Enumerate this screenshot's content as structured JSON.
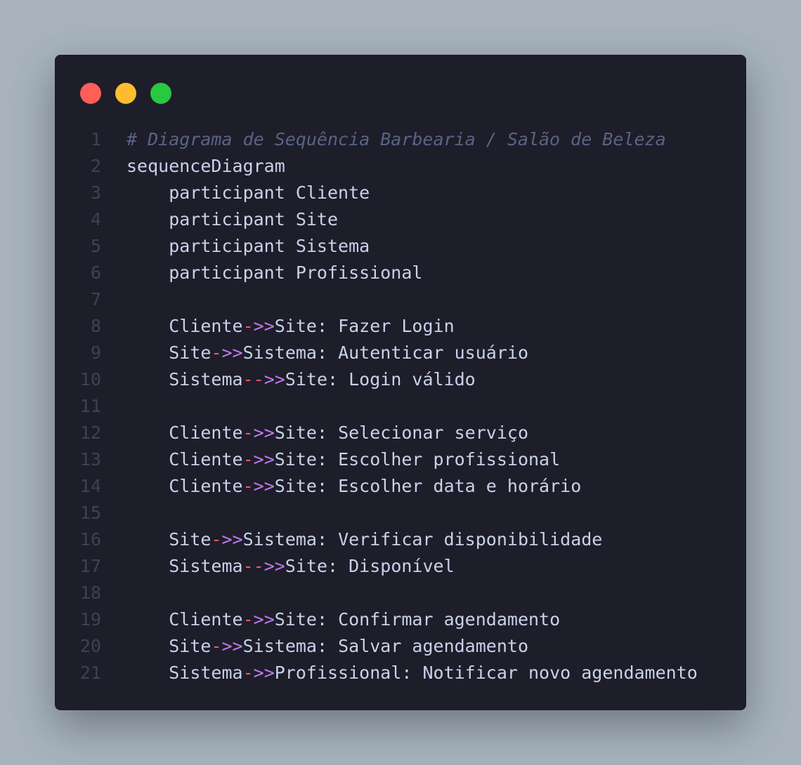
{
  "window": {
    "traffic_lights": [
      {
        "name": "close",
        "color": "#ff5f57"
      },
      {
        "name": "minimize",
        "color": "#ffbd2e"
      },
      {
        "name": "maximize",
        "color": "#28c840"
      }
    ]
  },
  "code": {
    "lines": [
      {
        "num": "1",
        "kind": "comment",
        "text": "# Diagrama de Sequência Barbearia / Salão de Beleza"
      },
      {
        "num": "2",
        "kind": "plain",
        "text": "sequenceDiagram"
      },
      {
        "num": "3",
        "kind": "plain",
        "text": "    participant Cliente"
      },
      {
        "num": "4",
        "kind": "plain",
        "text": "    participant Site"
      },
      {
        "num": "5",
        "kind": "plain",
        "text": "    participant Sistema"
      },
      {
        "num": "6",
        "kind": "plain",
        "text": "    participant Profissional"
      },
      {
        "num": "7",
        "kind": "plain",
        "text": ""
      },
      {
        "num": "8",
        "kind": "msg",
        "indent": "    ",
        "from": "Cliente",
        "arrow": "->>",
        "to": "Site",
        "message": ": Fazer Login"
      },
      {
        "num": "9",
        "kind": "msg",
        "indent": "    ",
        "from": "Site",
        "arrow": "->>",
        "to": "Sistema",
        "message": ": Autenticar usuário"
      },
      {
        "num": "10",
        "kind": "msg",
        "indent": "    ",
        "from": "Sistema",
        "arrow": "-->>",
        "to": "Site",
        "message": ": Login válido"
      },
      {
        "num": "11",
        "kind": "plain",
        "text": ""
      },
      {
        "num": "12",
        "kind": "msg",
        "indent": "    ",
        "from": "Cliente",
        "arrow": "->>",
        "to": "Site",
        "message": ": Selecionar serviço"
      },
      {
        "num": "13",
        "kind": "msg",
        "indent": "    ",
        "from": "Cliente",
        "arrow": "->>",
        "to": "Site",
        "message": ": Escolher profissional"
      },
      {
        "num": "14",
        "kind": "msg",
        "indent": "    ",
        "from": "Cliente",
        "arrow": "->>",
        "to": "Site",
        "message": ": Escolher data e horário"
      },
      {
        "num": "15",
        "kind": "plain",
        "text": ""
      },
      {
        "num": "16",
        "kind": "msg",
        "indent": "    ",
        "from": "Site",
        "arrow": "->>",
        "to": "Sistema",
        "message": ": Verificar disponibilidade"
      },
      {
        "num": "17",
        "kind": "msg",
        "indent": "    ",
        "from": "Sistema",
        "arrow": "-->>",
        "to": "Site",
        "message": ": Disponível"
      },
      {
        "num": "18",
        "kind": "plain",
        "text": ""
      },
      {
        "num": "19",
        "kind": "msg",
        "indent": "    ",
        "from": "Cliente",
        "arrow": "->>",
        "to": "Site",
        "message": ": Confirmar agendamento"
      },
      {
        "num": "20",
        "kind": "msg",
        "indent": "    ",
        "from": "Site",
        "arrow": "->>",
        "to": "Sistema",
        "message": ": Salvar agendamento"
      },
      {
        "num": "21",
        "kind": "msg",
        "indent": "    ",
        "from": "Sistema",
        "arrow": "->>",
        "to": "Profissional",
        "message": ": Notificar novo agendamento"
      }
    ]
  }
}
